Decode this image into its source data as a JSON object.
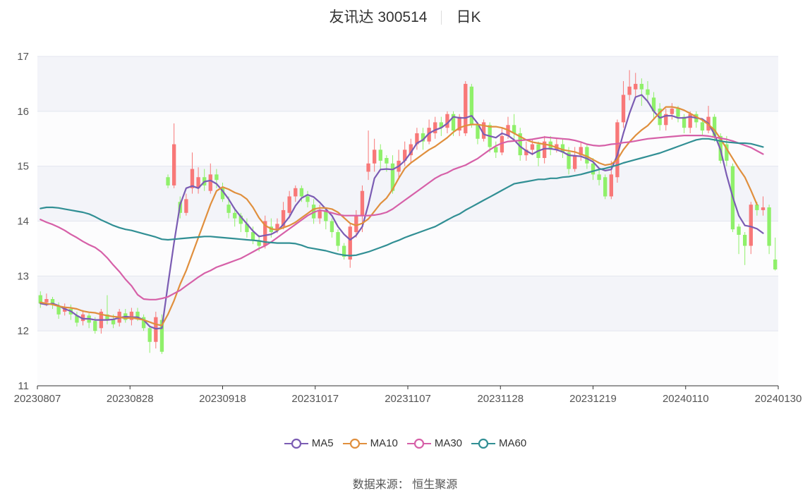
{
  "title": {
    "name": "友讯达 300514",
    "period": "日K"
  },
  "source_text": "数据来源： 恒生聚源",
  "chart_data": {
    "type": "candlestick",
    "y_range": [
      11,
      17
    ],
    "y_ticks": [
      "11",
      "12",
      "13",
      "14",
      "15",
      "16",
      "17"
    ],
    "x_tick_labels": [
      "20230807",
      "20230828",
      "20230918",
      "20231017",
      "20231107",
      "20231128",
      "20231219",
      "20240110",
      "20240130"
    ],
    "grid": true,
    "colors": {
      "up": "#f87878",
      "down": "#8ff06a",
      "band": "#f3f4f9"
    },
    "candles": [
      [
        12.65,
        12.5,
        12.72,
        12.42
      ],
      [
        12.52,
        12.58,
        12.68,
        12.45
      ],
      [
        12.58,
        12.48,
        12.62,
        12.4
      ],
      [
        12.45,
        12.3,
        12.52,
        12.22
      ],
      [
        12.35,
        12.42,
        12.5,
        12.28
      ],
      [
        12.4,
        12.3,
        12.48,
        12.2
      ],
      [
        12.28,
        12.15,
        12.35,
        12.08
      ],
      [
        12.18,
        12.3,
        12.38,
        12.1
      ],
      [
        12.28,
        12.15,
        12.32,
        12.05
      ],
      [
        12.18,
        12.0,
        12.25,
        11.95
      ],
      [
        12.05,
        12.35,
        12.4,
        11.95
      ],
      [
        12.3,
        12.2,
        12.65,
        12.12
      ],
      [
        12.22,
        12.12,
        12.3,
        12.05
      ],
      [
        12.15,
        12.35,
        12.4,
        12.08
      ],
      [
        12.32,
        12.2,
        12.4,
        12.15
      ],
      [
        12.2,
        12.35,
        12.42,
        12.1
      ],
      [
        12.35,
        12.25,
        12.42,
        12.18
      ],
      [
        12.25,
        12.05,
        12.3,
        12.0
      ],
      [
        12.05,
        11.8,
        12.1,
        11.6
      ],
      [
        11.8,
        12.25,
        12.35,
        11.68
      ],
      [
        12.2,
        11.62,
        12.3,
        11.58
      ],
      [
        14.8,
        14.65,
        14.85,
        14.6
      ],
      [
        14.65,
        15.4,
        15.78,
        14.6
      ],
      [
        14.35,
        14.15,
        14.45,
        14.05
      ],
      [
        14.15,
        14.4,
        14.5,
        14.1
      ],
      [
        14.6,
        14.95,
        15.25,
        14.5
      ],
      [
        14.6,
        14.8,
        14.98,
        14.5
      ],
      [
        14.8,
        14.65,
        14.95,
        14.55
      ],
      [
        14.55,
        14.85,
        15.05,
        14.5
      ],
      [
        14.85,
        14.75,
        14.95,
        14.6
      ],
      [
        14.6,
        14.4,
        14.7,
        14.35
      ],
      [
        14.3,
        14.15,
        14.45,
        14.05
      ],
      [
        14.15,
        14.05,
        14.25,
        13.9
      ],
      [
        14.1,
        13.95,
        14.15,
        13.8
      ],
      [
        13.95,
        13.8,
        14.05,
        13.7
      ],
      [
        13.8,
        13.65,
        13.9,
        13.58
      ],
      [
        13.65,
        13.55,
        13.75,
        13.45
      ],
      [
        13.55,
        14.0,
        14.1,
        13.5
      ],
      [
        13.9,
        13.8,
        14.05,
        13.7
      ],
      [
        13.85,
        13.95,
        14.05,
        13.78
      ],
      [
        13.9,
        14.2,
        14.35,
        13.85
      ],
      [
        14.15,
        14.45,
        14.55,
        14.05
      ],
      [
        14.45,
        14.6,
        14.65,
        14.35
      ],
      [
        14.6,
        14.45,
        14.65,
        14.35
      ],
      [
        14.45,
        14.35,
        14.55,
        14.25
      ],
      [
        14.3,
        14.05,
        14.4,
        13.95
      ],
      [
        14.05,
        14.2,
        14.3,
        13.95
      ],
      [
        14.2,
        14.0,
        14.25,
        13.85
      ],
      [
        14.0,
        13.8,
        14.05,
        13.7
      ],
      [
        13.8,
        13.55,
        13.85,
        13.45
      ],
      [
        13.55,
        13.35,
        13.6,
        13.3
      ],
      [
        13.3,
        13.9,
        13.95,
        13.15
      ],
      [
        13.8,
        14.1,
        14.2,
        13.7
      ],
      [
        14.1,
        14.55,
        14.65,
        13.8
      ],
      [
        14.9,
        15.05,
        15.65,
        14.75
      ],
      [
        15.05,
        15.3,
        15.5,
        14.9
      ],
      [
        15.3,
        15.1,
        15.4,
        14.95
      ],
      [
        15.15,
        15.05,
        15.2,
        14.9
      ],
      [
        15.05,
        14.55,
        15.2,
        14.5
      ],
      [
        14.9,
        15.1,
        15.3,
        14.8
      ],
      [
        15.1,
        15.3,
        15.45,
        15.0
      ],
      [
        15.2,
        15.4,
        15.5,
        15.05
      ],
      [
        15.4,
        15.6,
        15.7,
        15.3
      ],
      [
        15.6,
        15.45,
        15.7,
        15.3
      ],
      [
        15.45,
        15.7,
        15.85,
        15.4
      ],
      [
        15.6,
        15.8,
        15.9,
        15.5
      ],
      [
        15.8,
        15.7,
        15.9,
        15.55
      ],
      [
        15.7,
        15.95,
        16.0,
        15.6
      ],
      [
        15.95,
        15.65,
        16.0,
        15.55
      ],
      [
        15.65,
        15.9,
        15.95,
        15.55
      ],
      [
        15.6,
        16.5,
        16.55,
        15.55
      ],
      [
        16.45,
        15.75,
        16.5,
        15.7
      ],
      [
        15.75,
        15.5,
        15.8,
        15.4
      ],
      [
        15.5,
        15.8,
        15.85,
        15.45
      ],
      [
        15.75,
        15.35,
        15.8,
        15.25
      ],
      [
        15.35,
        15.25,
        15.45,
        15.15
      ],
      [
        15.25,
        15.55,
        15.7,
        15.2
      ],
      [
        15.55,
        15.75,
        15.9,
        15.5
      ],
      [
        15.75,
        15.6,
        15.95,
        15.5
      ],
      [
        15.6,
        15.2,
        15.7,
        15.1
      ],
      [
        15.2,
        15.3,
        15.45,
        15.1
      ],
      [
        15.3,
        15.4,
        15.5,
        15.2
      ],
      [
        15.4,
        15.15,
        15.45,
        15.0
      ],
      [
        15.15,
        15.45,
        15.55,
        15.05
      ],
      [
        15.45,
        15.3,
        15.55,
        15.2
      ],
      [
        15.3,
        15.4,
        15.5,
        15.25
      ],
      [
        15.4,
        15.25,
        15.5,
        15.15
      ],
      [
        15.25,
        14.95,
        15.35,
        14.85
      ],
      [
        14.95,
        15.2,
        15.35,
        14.9
      ],
      [
        15.2,
        15.35,
        15.45,
        15.1
      ],
      [
        15.35,
        15.05,
        15.4,
        14.95
      ],
      [
        15.05,
        14.85,
        15.15,
        14.75
      ],
      [
        14.85,
        14.75,
        14.95,
        14.65
      ],
      [
        14.8,
        14.45,
        14.85,
        14.4
      ],
      [
        14.45,
        14.85,
        15.1,
        14.4
      ],
      [
        14.8,
        15.8,
        15.85,
        14.7
      ],
      [
        15.8,
        16.3,
        16.55,
        15.7
      ],
      [
        16.3,
        16.45,
        16.75,
        16.2
      ],
      [
        16.4,
        16.5,
        16.7,
        16.25
      ],
      [
        16.5,
        16.4,
        16.6,
        16.1
      ],
      [
        16.4,
        16.3,
        16.55,
        16.15
      ],
      [
        16.25,
        16.0,
        16.35,
        15.85
      ],
      [
        16.05,
        15.75,
        16.15,
        15.65
      ],
      [
        15.75,
        15.95,
        16.05,
        15.65
      ],
      [
        15.95,
        16.05,
        16.15,
        15.85
      ],
      [
        16.05,
        15.9,
        16.1,
        15.8
      ],
      [
        15.9,
        15.7,
        15.95,
        15.6
      ],
      [
        15.7,
        15.95,
        16.0,
        15.6
      ],
      [
        15.95,
        15.8,
        16.0,
        15.7
      ],
      [
        15.8,
        15.65,
        15.85,
        15.55
      ],
      [
        15.65,
        15.9,
        16.1,
        15.6
      ],
      [
        15.9,
        15.55,
        15.95,
        15.45
      ],
      [
        15.55,
        15.1,
        15.6,
        15.05
      ],
      [
        15.4,
        15.1,
        15.55,
        15.0
      ],
      [
        15.0,
        13.85,
        15.05,
        13.8
      ],
      [
        13.9,
        13.75,
        13.95,
        13.4
      ],
      [
        13.75,
        13.55,
        13.8,
        13.2
      ],
      [
        13.55,
        14.3,
        14.35,
        13.4
      ],
      [
        14.3,
        14.2,
        14.35,
        14.1
      ],
      [
        14.2,
        14.25,
        14.45,
        14.1
      ],
      [
        14.25,
        13.55,
        14.3,
        13.4
      ],
      [
        13.3,
        13.12,
        13.7,
        13.1
      ]
    ],
    "series": [
      {
        "name": "MA5",
        "color": "#7b5cb3",
        "values": [
          12.5,
          12.48,
          12.5,
          12.46,
          12.4,
          12.36,
          12.28,
          12.22,
          12.22,
          12.2,
          12.2,
          12.2,
          12.21,
          12.24,
          12.26,
          12.25,
          12.25,
          12.2,
          12.08,
          12.04,
          12.05,
          12.84,
          13.6,
          14.3,
          14.6,
          14.64,
          14.6,
          14.72,
          14.74,
          14.68,
          14.55,
          14.4,
          14.22,
          14.08,
          13.95,
          13.82,
          13.72,
          13.74,
          13.76,
          13.82,
          13.94,
          14.08,
          14.28,
          14.42,
          14.48,
          14.44,
          14.34,
          14.22,
          14.1,
          13.9,
          13.76,
          13.66,
          13.74,
          13.9,
          14.3,
          14.78,
          14.94,
          14.95,
          14.94,
          15.0,
          15.1,
          15.25,
          15.42,
          15.48,
          15.6,
          15.66,
          15.7,
          15.78,
          15.9,
          15.88,
          15.88,
          15.92,
          15.78,
          15.58,
          15.55,
          15.52,
          15.6,
          15.56,
          15.48,
          15.36,
          15.28,
          15.22,
          15.28,
          15.32,
          15.32,
          15.3,
          15.26,
          15.2,
          15.19,
          15.18,
          15.14,
          15.08,
          14.96,
          14.92,
          14.94,
          15.2,
          15.6,
          15.96,
          16.26,
          16.3,
          16.18,
          16.0,
          15.88,
          15.92,
          15.92,
          15.88,
          15.88,
          15.9,
          15.88,
          15.86,
          15.78,
          15.58,
          15.3,
          14.84,
          14.44,
          14.1,
          13.92,
          13.9,
          13.86,
          13.78
        ]
      },
      {
        "name": "MA10",
        "color": "#e08f3d",
        "values": [
          12.52,
          12.5,
          12.48,
          12.45,
          12.43,
          12.42,
          12.4,
          12.36,
          12.34,
          12.33,
          12.3,
          12.28,
          12.26,
          12.25,
          12.23,
          12.24,
          12.22,
          12.2,
          12.16,
          12.12,
          12.1,
          12.3,
          12.55,
          12.85,
          13.1,
          13.4,
          13.7,
          14.0,
          14.3,
          14.55,
          14.62,
          14.58,
          14.52,
          14.48,
          14.4,
          14.25,
          14.06,
          13.92,
          13.86,
          13.84,
          13.88,
          13.92,
          13.98,
          14.06,
          14.14,
          14.22,
          14.24,
          14.24,
          14.22,
          14.16,
          14.06,
          13.96,
          13.92,
          13.96,
          14.04,
          14.18,
          14.32,
          14.42,
          14.58,
          14.78,
          14.96,
          15.06,
          15.14,
          15.22,
          15.3,
          15.36,
          15.44,
          15.52,
          15.62,
          15.7,
          15.74,
          15.76,
          15.76,
          15.74,
          15.72,
          15.72,
          15.7,
          15.66,
          15.6,
          15.54,
          15.48,
          15.44,
          15.42,
          15.4,
          15.38,
          15.34,
          15.3,
          15.28,
          15.26,
          15.22,
          15.18,
          15.12,
          15.06,
          15.02,
          15.04,
          15.12,
          15.3,
          15.44,
          15.56,
          15.66,
          15.74,
          15.86,
          15.98,
          16.08,
          16.08,
          16.06,
          16.02,
          15.96,
          15.9,
          15.84,
          15.76,
          15.66,
          15.5,
          15.32,
          15.14,
          14.96,
          14.8,
          14.56,
          14.3
        ]
      },
      {
        "name": "MA30",
        "color": "#d660a8",
        "values": [
          14.03,
          13.98,
          13.94,
          13.89,
          13.83,
          13.76,
          13.7,
          13.63,
          13.57,
          13.52,
          13.44,
          13.33,
          13.2,
          13.08,
          12.94,
          12.82,
          12.66,
          12.58,
          12.57,
          12.57,
          12.59,
          12.62,
          12.68,
          12.74,
          12.82,
          12.9,
          12.98,
          13.05,
          13.1,
          13.16,
          13.2,
          13.24,
          13.28,
          13.32,
          13.38,
          13.44,
          13.5,
          13.55,
          13.62,
          13.7,
          13.78,
          13.86,
          13.94,
          14.02,
          14.1,
          14.16,
          14.2,
          14.18,
          14.15,
          14.12,
          14.1,
          14.1,
          14.1,
          14.1,
          14.1,
          14.11,
          14.13,
          14.16,
          14.22,
          14.3,
          14.38,
          14.46,
          14.54,
          14.62,
          14.7,
          14.78,
          14.84,
          14.88,
          14.94,
          14.98,
          15.02,
          15.08,
          15.14,
          15.22,
          15.3,
          15.37,
          15.42,
          15.45,
          15.46,
          15.47,
          15.48,
          15.49,
          15.51,
          15.53,
          15.52,
          15.51,
          15.5,
          15.49,
          15.47,
          15.44,
          15.4,
          15.38,
          15.37,
          15.38,
          15.4,
          15.41,
          15.43,
          15.44,
          15.46,
          15.48,
          15.5,
          15.51,
          15.52,
          15.53,
          15.54,
          15.55,
          15.56,
          15.56,
          15.56,
          15.56,
          15.55,
          15.53,
          15.51,
          15.49,
          15.46,
          15.42,
          15.38,
          15.34,
          15.28,
          15.22
        ]
      },
      {
        "name": "MA60",
        "color": "#318f94",
        "values": [
          14.23,
          14.25,
          14.25,
          14.24,
          14.22,
          14.2,
          14.18,
          14.16,
          14.13,
          14.08,
          14.02,
          13.97,
          13.92,
          13.88,
          13.85,
          13.83,
          13.8,
          13.77,
          13.74,
          13.71,
          13.67,
          13.66,
          13.67,
          13.68,
          13.69,
          13.7,
          13.71,
          13.72,
          13.72,
          13.71,
          13.7,
          13.69,
          13.68,
          13.67,
          13.66,
          13.65,
          13.64,
          13.62,
          13.61,
          13.6,
          13.6,
          13.6,
          13.59,
          13.56,
          13.52,
          13.5,
          13.48,
          13.46,
          13.43,
          13.4,
          13.38,
          13.37,
          13.38,
          13.41,
          13.44,
          13.48,
          13.52,
          13.56,
          13.61,
          13.65,
          13.7,
          13.74,
          13.78,
          13.82,
          13.86,
          13.9,
          13.96,
          14.02,
          14.08,
          14.13,
          14.2,
          14.26,
          14.32,
          14.38,
          14.44,
          14.5,
          14.56,
          14.62,
          14.68,
          14.7,
          14.72,
          14.74,
          14.76,
          14.76,
          14.78,
          14.78,
          14.8,
          14.81,
          14.83,
          14.85,
          14.88,
          14.91,
          14.94,
          14.96,
          14.99,
          15.02,
          15.06,
          15.09,
          15.12,
          15.15,
          15.18,
          15.21,
          15.24,
          15.28,
          15.32,
          15.36,
          15.4,
          15.44,
          15.48,
          15.5,
          15.5,
          15.48,
          15.46,
          15.44,
          15.43,
          15.42,
          15.42,
          15.41,
          15.38,
          15.35
        ]
      }
    ]
  }
}
